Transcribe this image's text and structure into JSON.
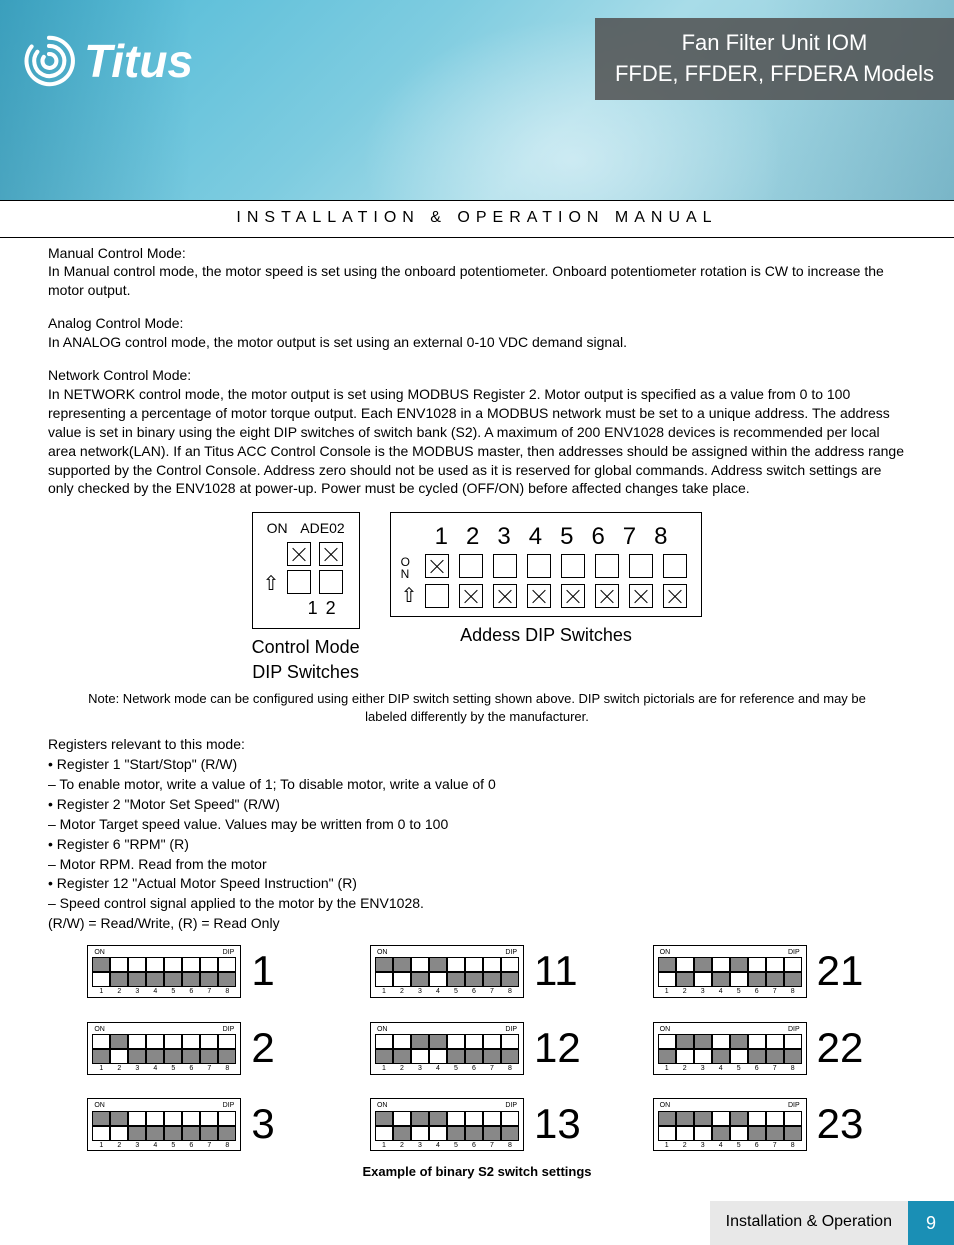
{
  "header": {
    "brand": "Titus",
    "title_line1": "Fan Filter Unit IOM",
    "title_line2": "FFDE, FFDER, FFDERA Models"
  },
  "section_title": "INSTALLATION & OPERATION MANUAL",
  "modes": {
    "manual": {
      "label": "Manual Control Mode:",
      "text": "In Manual control mode, the motor speed is set using the onboard potentiometer. Onboard potentiometer rotation is CW to increase the motor output."
    },
    "analog": {
      "label": "Analog Control Mode:",
      "text": "In ANALOG control mode, the motor output is set using an external 0-10 VDC demand signal."
    },
    "network": {
      "label": "Network Control Mode:",
      "text": "In NETWORK control mode, the motor output is set using MODBUS Register 2. Motor output is specified as a value from 0 to 100 representing a percentage of motor torque output. Each ENV1028 in a MODBUS network must be set to a unique address. The address value is set in binary using the eight DIP switches of switch bank (S2). A maximum of 200 ENV1028 devices is recommended per local area network(LAN). If an Titus ACC Control Console is the MODBUS master, then addresses should be assigned within the address range supported by the Control Console. Address zero should not be used as it is reserved for global commands. Address switch settings are only checked by the ENV1028 at power-up. Power must be cycled (OFF/ON) before affected changes take place."
    }
  },
  "dip_control": {
    "on": "ON",
    "label": "ADE02",
    "nums": [
      "1",
      "2"
    ],
    "caption1": "Control Mode",
    "caption2": "DIP Switches"
  },
  "dip_address": {
    "cols": [
      "1",
      "2",
      "3",
      "4",
      "5",
      "6",
      "7",
      "8"
    ],
    "on_o": "O",
    "on_n": "N",
    "caption": "Addess DIP Switches"
  },
  "note": "Note: Network mode can be configured using either DIP switch setting shown above. DIP switch pictorials are for reference and may be labeled differently by the manufacturer.",
  "registers": {
    "intro": "Registers relevant to this mode:",
    "lines": [
      "• Register 1 \"Start/Stop\" (R/W)",
      "– To enable motor, write a value of 1; To disable motor, write a value of 0",
      "• Register 2 \"Motor Set Speed\" (R/W)",
      "– Motor Target speed value. Values may be written from 0 to 100",
      "• Register 6 \"RPM\" (R)",
      "– Motor RPM. Read from the motor",
      "• Register 12 \"Actual Motor Speed Instruction\" (R)",
      "– Speed control signal applied to the motor by the ENV1028.",
      "(R/W) = Read/Write, (R) = Read Only"
    ]
  },
  "switch_examples": {
    "on": "ON",
    "dip": "DIP",
    "cols": [
      "1",
      "2",
      "3",
      "4",
      "5",
      "6",
      "7",
      "8"
    ],
    "items": [
      {
        "num": "1",
        "pattern": [
          1,
          0,
          0,
          0,
          0,
          0,
          0,
          0
        ]
      },
      {
        "num": "11",
        "pattern": [
          1,
          1,
          0,
          1,
          0,
          0,
          0,
          0
        ]
      },
      {
        "num": "21",
        "pattern": [
          1,
          0,
          1,
          0,
          1,
          0,
          0,
          0
        ]
      },
      {
        "num": "2",
        "pattern": [
          0,
          1,
          0,
          0,
          0,
          0,
          0,
          0
        ]
      },
      {
        "num": "12",
        "pattern": [
          0,
          0,
          1,
          1,
          0,
          0,
          0,
          0
        ]
      },
      {
        "num": "22",
        "pattern": [
          0,
          1,
          1,
          0,
          1,
          0,
          0,
          0
        ]
      },
      {
        "num": "3",
        "pattern": [
          1,
          1,
          0,
          0,
          0,
          0,
          0,
          0
        ]
      },
      {
        "num": "13",
        "pattern": [
          1,
          0,
          1,
          1,
          0,
          0,
          0,
          0
        ]
      },
      {
        "num": "23",
        "pattern": [
          1,
          1,
          1,
          0,
          1,
          0,
          0,
          0
        ]
      }
    ],
    "caption": "Example of binary S2 switch settings"
  },
  "footer": {
    "text": "Installation & Operation",
    "page": "9"
  }
}
